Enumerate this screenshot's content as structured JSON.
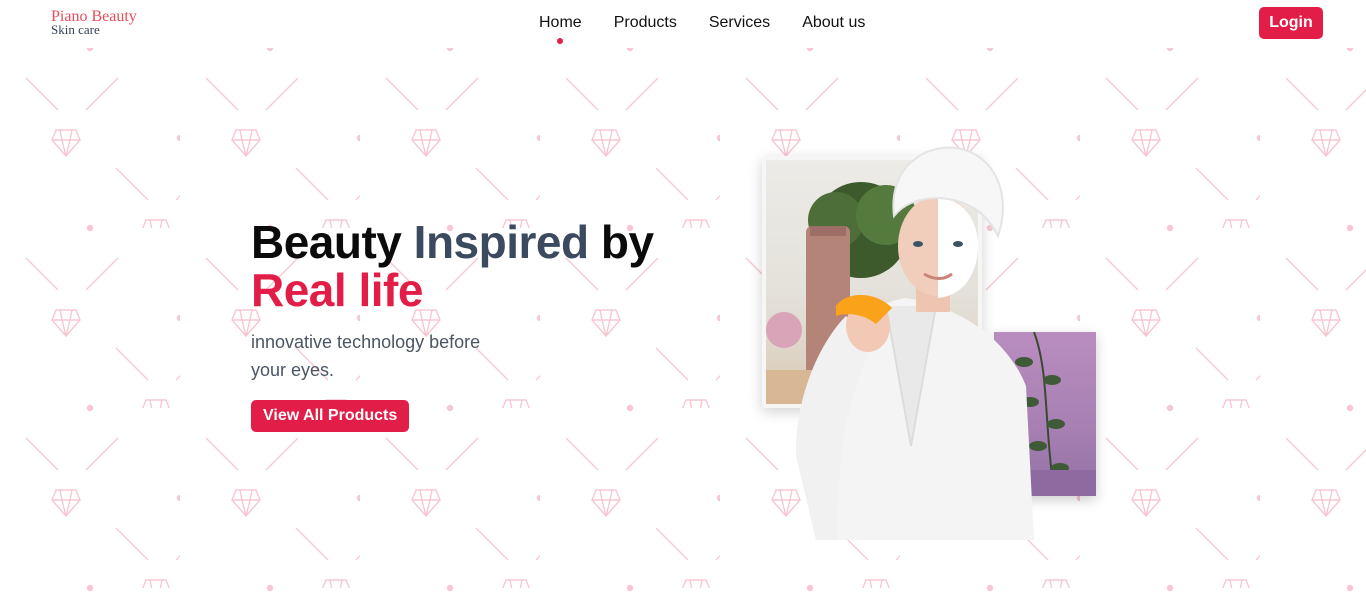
{
  "brand": {
    "name": "Piano Beauty",
    "tagline": "Skin care"
  },
  "nav": [
    {
      "label": "Home",
      "active": true
    },
    {
      "label": "Products",
      "active": false
    },
    {
      "label": "Services",
      "active": false
    },
    {
      "label": "About us",
      "active": false
    }
  ],
  "header": {
    "login_label": "Login"
  },
  "hero": {
    "title_part1": "Beauty ",
    "title_part2": "Inspired",
    "title_part3": " by",
    "title_line2": "Real life",
    "subtitle": "innovative technology before your eyes.",
    "cta_label": "View All Products"
  },
  "colors": {
    "accent": "#e11d48",
    "logo": "#e84b5a",
    "slate": "#3b4a5e",
    "pattern": "#f7c7d3"
  },
  "icons": {
    "background_motif": "diamond-icon"
  }
}
